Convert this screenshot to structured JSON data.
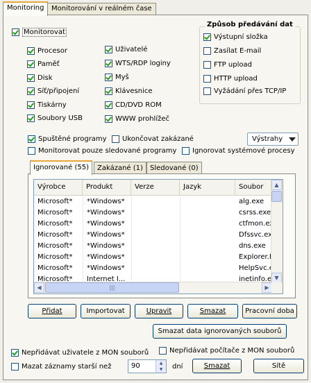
{
  "tabs": [
    "Monitoring",
    "Monitorování v reálném čase"
  ],
  "monitor": {
    "label": "Monitorovat",
    "checked": true
  },
  "left_options": [
    {
      "label": "Procesor",
      "checked": true
    },
    {
      "label": "Paměť",
      "checked": true
    },
    {
      "label": "Disk",
      "checked": true
    },
    {
      "label": "Síť/připojení",
      "checked": true
    },
    {
      "label": "Tiskárny",
      "checked": true
    },
    {
      "label": "Soubory USB",
      "checked": true
    }
  ],
  "mid_options": [
    {
      "label": "Uživatelé",
      "checked": true
    },
    {
      "label": "WTS/RDP loginy",
      "checked": true
    },
    {
      "label": "Myš",
      "checked": true
    },
    {
      "label": "Klávesnice",
      "checked": true
    },
    {
      "label": "CD/DVD ROM",
      "checked": true
    },
    {
      "label": "WWW prohlížeč",
      "checked": true
    }
  ],
  "delivery": {
    "title": "Způsob předávání dat",
    "options": [
      {
        "label": "Výstupní složka",
        "checked": true
      },
      {
        "label": "Zasílat E-mail",
        "checked": false
      },
      {
        "label": "FTP upload",
        "checked": false
      },
      {
        "label": "HTTP upload",
        "checked": false
      },
      {
        "label": "Vyžádání přes TCP/IP",
        "checked": false
      }
    ]
  },
  "programs": {
    "running": {
      "label": "Spuštěné programy",
      "checked": true
    },
    "terminate_forbidden": {
      "label": "Ukončovat zakázané",
      "checked": false
    },
    "only_watched": {
      "label": "Monitorovat pouze sledované programy",
      "checked": false
    },
    "ignore_system": {
      "label": "Ignorovat systémové procesy",
      "checked": false
    },
    "alerts_label": "Výstrahy"
  },
  "inner_tabs": [
    "Ignorované (55)",
    "Zakázané (1)",
    "Sledované (0)"
  ],
  "table": {
    "columns": [
      "Výrobce",
      "Produkt",
      "Verze",
      "Jazyk",
      "Soubor"
    ],
    "rows": [
      [
        "Microsoft*",
        "*Windows*",
        "",
        "",
        "alg.exe"
      ],
      [
        "Microsoft*",
        "*Windows*",
        "",
        "",
        "csrss.exe"
      ],
      [
        "Microsoft*",
        "*Windows*",
        "",
        "",
        "ctfmon.exe"
      ],
      [
        "Microsoft*",
        "*Windows*",
        "",
        "",
        "Dfssvc.exe"
      ],
      [
        "Microsoft*",
        "*Windows*",
        "",
        "",
        "dns.exe"
      ],
      [
        "Microsoft*",
        "*Windows*",
        "",
        "",
        "Explorer.EXE"
      ],
      [
        "Microsoft*",
        "*Windows*",
        "",
        "",
        "HelpSvc.exe"
      ],
      [
        "Microsoft*",
        "Internet I...",
        "",
        "",
        "inetinfo.exe"
      ]
    ]
  },
  "buttons": {
    "add": "Přidat",
    "import": "Importovat",
    "edit": "Upravit",
    "delete": "Smazat",
    "workhours": "Pracovní doba",
    "clear_ignored": "Smazat data ignorovaných souborů"
  },
  "bottom": {
    "no_users": {
      "label": "Nepřidávat uživatele z MON souborů",
      "checked": true
    },
    "no_computers": {
      "label": "Nepřidávat počítače z MON souborů",
      "checked": false
    },
    "delete_older": {
      "label": "Mazat záznamy starší než",
      "checked": false
    },
    "days_value": "90",
    "days_unit": "dní",
    "delete_button": "Smazat",
    "networks_button": "Sítě"
  }
}
